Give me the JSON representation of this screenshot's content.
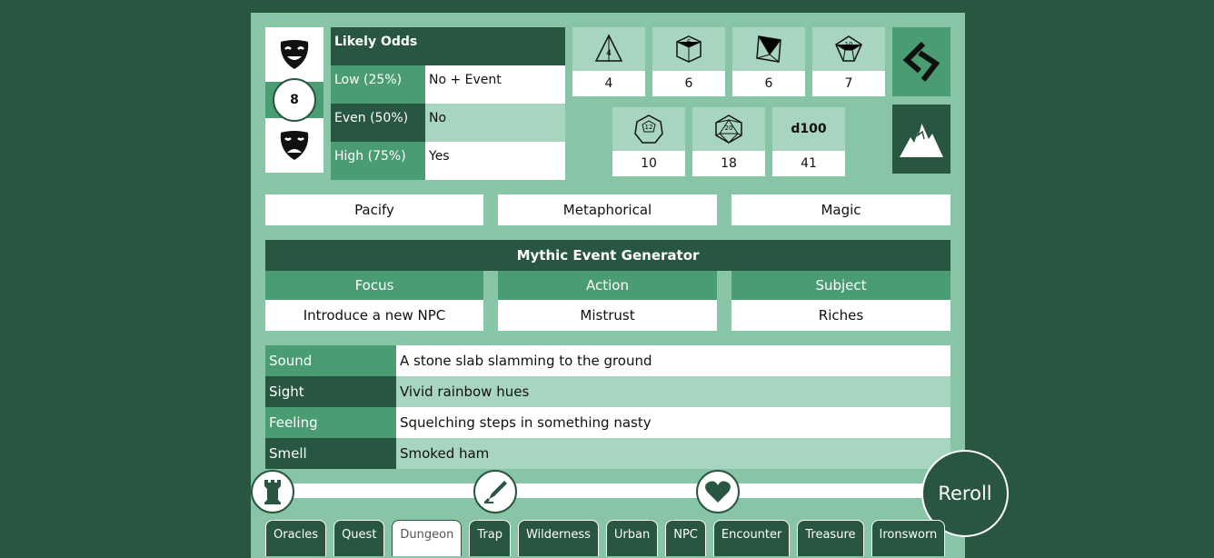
{
  "chaos": {
    "value": "8"
  },
  "odds": {
    "title": "Likely Odds",
    "rows": [
      {
        "label": "Low (25%)",
        "value": "No + Event"
      },
      {
        "label": "Even (50%)",
        "value": "No"
      },
      {
        "label": "High (75%)",
        "value": "Yes"
      }
    ]
  },
  "dice": [
    {
      "face": "4",
      "value": "4"
    },
    {
      "face": "6",
      "value": "6"
    },
    {
      "face": "8",
      "value": "6"
    },
    {
      "face": "10",
      "value": "7"
    },
    {
      "face": "12",
      "value": "10"
    },
    {
      "face": "20",
      "value": "18"
    },
    {
      "face": "d100",
      "value": "41"
    }
  ],
  "words": [
    "Pacify",
    "Metaphorical",
    "Magic"
  ],
  "event_generator": {
    "title": "Mythic Event Generator",
    "columns": [
      {
        "header": "Focus",
        "value": "Introduce a new NPC"
      },
      {
        "header": "Action",
        "value": "Mistrust"
      },
      {
        "header": "Subject",
        "value": "Riches"
      }
    ]
  },
  "senses": [
    {
      "label": "Sound",
      "value": "A stone slab slamming to the ground"
    },
    {
      "label": "Sight",
      "value": "Vivid rainbow hues"
    },
    {
      "label": "Feeling",
      "value": "Squelching steps in something nasty"
    },
    {
      "label": "Smell",
      "value": "Smoked ham"
    }
  ],
  "reroll_label": "Reroll",
  "tabs": [
    {
      "label": "Oracles"
    },
    {
      "label": "Quest"
    },
    {
      "label": "Dungeon",
      "active": true
    },
    {
      "label": "Trap"
    },
    {
      "label": "Wilderness"
    },
    {
      "label": "Urban"
    },
    {
      "label": "NPC"
    },
    {
      "label": "Encounter"
    },
    {
      "label": "Treasure"
    },
    {
      "label": "Ironsworn"
    }
  ],
  "colors": {
    "dark": "#285640",
    "mid": "#4a9c72",
    "panel": "#88c4a6",
    "light": "#a8d5c0"
  },
  "icons": {
    "chaos_top": "comedy-mask-icon",
    "chaos_bottom": "tragedy-mask-icon",
    "side_top": "ironsworn-rune-icon",
    "side_bottom": "mountain-icon",
    "knobs": [
      "tower-icon",
      "quill-icon",
      "heart-icon"
    ]
  }
}
